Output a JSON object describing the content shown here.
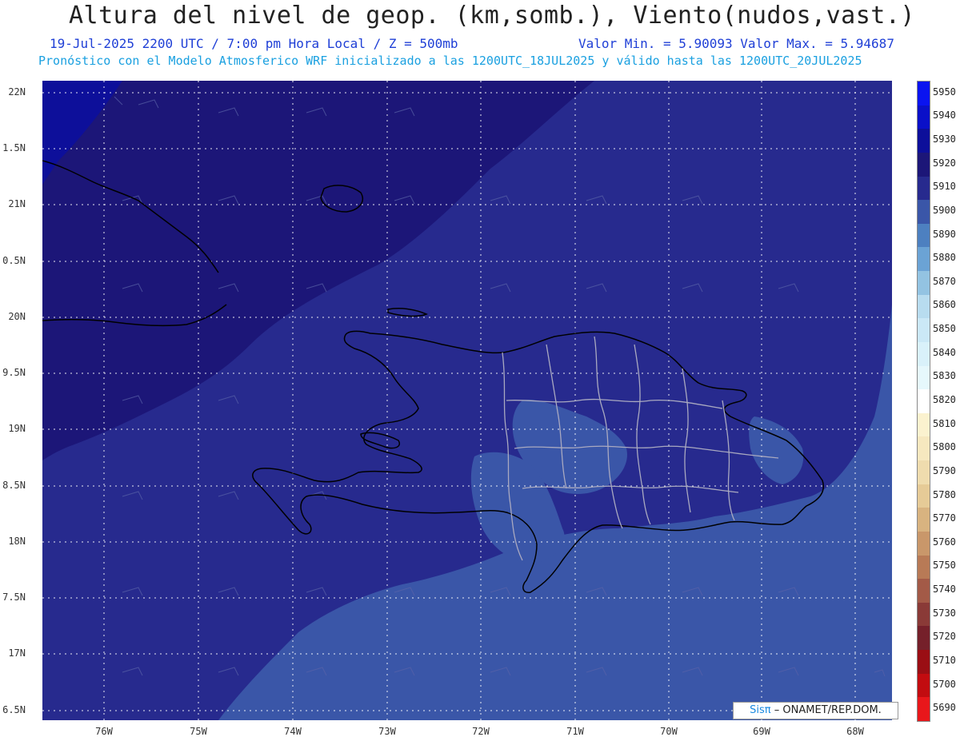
{
  "title": "Altura del nivel de geop. (km,somb.), Viento(nudos,vast.)",
  "subtitle_left": "19-Jul-2025   2200 UTC / 7:00 pm Hora Local / Z = 500mb",
  "subtitle_right": "Valor Min. = 5.90093  Valor Max. = 5.94687",
  "subtitle2": "Pronóstico con el Modelo Atmosferico WRF inicializado a las 1200UTC_18JUL2025 y válido hasta las  1200UTC_20JUL2025",
  "lat_labels": [
    "22N",
    "1.5N",
    "21N",
    "0.5N",
    "20N",
    "9.5N",
    "19N",
    "8.5N",
    "18N",
    "7.5N",
    "17N",
    "6.5N"
  ],
  "lon_labels": [
    "76W",
    "75W",
    "74W",
    "73W",
    "72W",
    "71W",
    "70W",
    "69W",
    "68W"
  ],
  "colorbar": {
    "labels": [
      "5950",
      "5940",
      "5930",
      "5920",
      "5910",
      "5900",
      "5890",
      "5880",
      "5870",
      "5860",
      "5850",
      "5840",
      "5830",
      "5820",
      "5810",
      "5800",
      "5790",
      "5780",
      "5770",
      "5760",
      "5750",
      "5740",
      "5730",
      "5720",
      "5710",
      "5700",
      "5690"
    ],
    "colors": [
      "#0a14f0",
      "#0a10c8",
      "#0d0f9a",
      "#1c1678",
      "#272a8e",
      "#3a56a8",
      "#4d80c0",
      "#6ba3d5",
      "#93c3e2",
      "#b8dcef",
      "#cbe8f6",
      "#d9f1fa",
      "#e6f8fc",
      "#ffffff",
      "#fbf2cf",
      "#f6e8bf",
      "#efdcae",
      "#e6cb97",
      "#d8b380",
      "#c9976a",
      "#b87a56",
      "#a35a47",
      "#8a3a37",
      "#75202a",
      "#9a0e14",
      "#c20c10",
      "#e8171b"
    ]
  },
  "legend_fill": {
    "5930": "#1c1678",
    "5920": "#272a8e",
    "5910": "#3a56a8"
  },
  "credit": {
    "logo": "Sisπ",
    "text": "– ONAMET/REP.DOM."
  }
}
